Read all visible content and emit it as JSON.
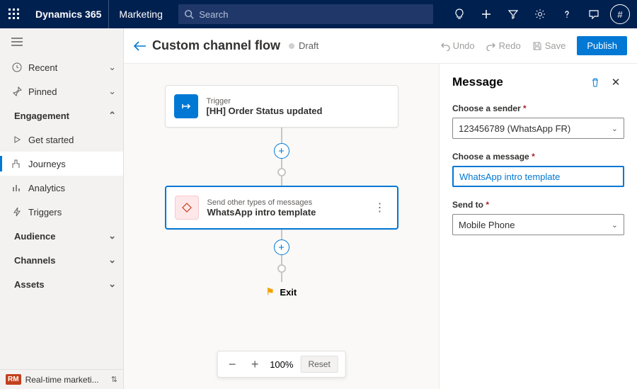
{
  "topbar": {
    "brand": "Dynamics 365",
    "module": "Marketing",
    "search_placeholder": "Search",
    "avatar_initial": "#"
  },
  "sidebar": {
    "recent": "Recent",
    "pinned": "Pinned",
    "engagement": "Engagement",
    "get_started": "Get started",
    "journeys": "Journeys",
    "analytics": "Analytics",
    "triggers": "Triggers",
    "audience": "Audience",
    "channels": "Channels",
    "assets": "Assets",
    "bottom_badge": "RM",
    "bottom_label": "Real-time marketi..."
  },
  "header": {
    "title": "Custom channel flow",
    "status": "Draft",
    "undo": "Undo",
    "redo": "Redo",
    "save": "Save",
    "publish": "Publish"
  },
  "flow": {
    "trigger_over": "Trigger",
    "trigger_name": "[HH] Order Status updated",
    "msg_over": "Send other types of messages",
    "msg_name": "WhatsApp intro template",
    "exit": "Exit",
    "zoom": "100%",
    "reset": "Reset"
  },
  "panel": {
    "title": "Message",
    "sender_label": "Choose a sender",
    "sender_value": "123456789 (WhatsApp FR)",
    "message_label": "Choose a message",
    "message_value": "WhatsApp intro template",
    "sendto_label": "Send to",
    "sendto_value": "Mobile Phone"
  }
}
